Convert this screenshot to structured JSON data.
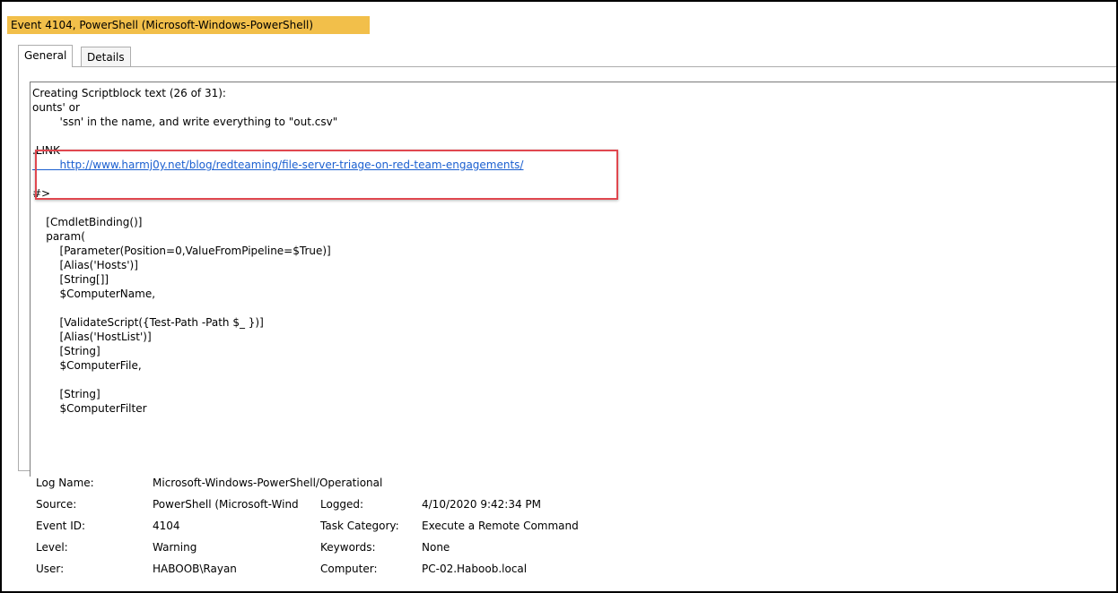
{
  "window_title": "Event 4104, PowerShell (Microsoft-Windows-PowerShell)",
  "tabs": [
    {
      "label": "General",
      "active": true
    },
    {
      "label": "Details",
      "active": false
    }
  ],
  "script_lines": [
    "Creating Scriptblock text (26 of 31):",
    "ounts' or",
    "        'ssn' in the name, and write everything to \"out.csv\"",
    "",
    "    .LINK",
    "        http://www.harmj0y.net/blog/redteaming/file-server-triage-on-red-team-engagements/",
    "",
    "#>",
    "",
    "    [CmdletBinding()]",
    "    param(",
    "        [Parameter(Position=0,ValueFromPipeline=$True)]",
    "        [Alias('Hosts')]",
    "        [String[]]",
    "        $ComputerName,",
    "",
    "        [ValidateScript({Test-Path -Path $_ })]",
    "        [Alias('HostList')]",
    "        [String]",
    "        $ComputerFile,",
    "",
    "        [String]",
    "        $ComputerFilter"
  ],
  "link_label": ".LINK",
  "link_url": "http://www.harmj0y.net/blog/redteaming/file-server-triage-on-red-team-engagements/",
  "details": {
    "log_name_label": "Log Name:",
    "log_name": "Microsoft-Windows-PowerShell/Operational",
    "source_label": "Source:",
    "source": "PowerShell (Microsoft-Wind",
    "logged_label": "Logged:",
    "logged": "4/10/2020 9:42:34 PM",
    "event_id_label": "Event ID:",
    "event_id": "4104",
    "task_category_label": "Task Category:",
    "task_category": "Execute a Remote Command",
    "level_label": "Level:",
    "level": "Warning",
    "keywords_label": "Keywords:",
    "keywords": "None",
    "user_label": "User:",
    "user": "HABOOB\\Rayan",
    "computer_label": "Computer:",
    "computer": "PC-02.Haboob.local"
  },
  "colors": {
    "title_highlight": "#f2bf4a",
    "annotation_box": "#e0474f",
    "link": "#1a5fd0"
  }
}
